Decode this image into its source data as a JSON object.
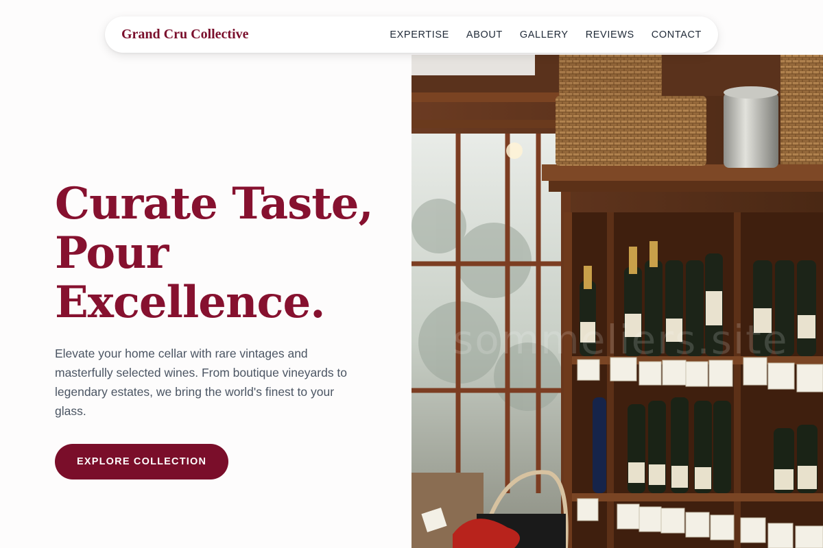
{
  "nav": {
    "brand": "Grand Cru Collective",
    "links": [
      "EXPERTISE",
      "ABOUT",
      "GALLERY",
      "REVIEWS",
      "CONTACT"
    ]
  },
  "hero": {
    "headline_lines": [
      "Curate Taste,",
      "Pour",
      "Excellence."
    ],
    "lead": "Elevate your home cellar with rare vintages and masterfully selected wines. From boutique vineyards to legendary estates, we bring the world's finest to your glass.",
    "cta_label": "EXPLORE COLLECTION"
  },
  "image": {
    "subject": "wine shop shelves with bottles, baskets and window",
    "watermark": "sommeliers.site"
  },
  "colors": {
    "accent": "#86112f",
    "button": "#7a0e2a",
    "body_text": "#4b5563",
    "nav_text": "#1f2937"
  }
}
